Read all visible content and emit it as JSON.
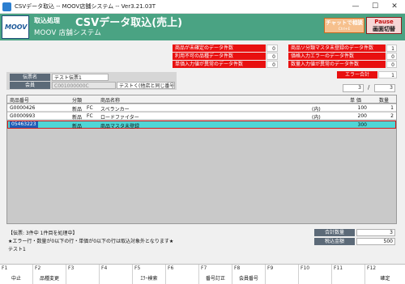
{
  "window": {
    "title": "CSVデータ取込 -- MOOV店舗システム -- Ver3.21.03T",
    "minimize": "—",
    "maximize": "☐",
    "close": "✕"
  },
  "header": {
    "logo_text": "MOOV",
    "mode_label": "取込処理",
    "screen_title": "CSVデータ取込(売上)",
    "system_name": "MOOV 店舗システム",
    "chat_button": "チャットで相談",
    "chat_shortcut": "Ctrl+E",
    "pause_label": "Pause",
    "pause_sub": "画面切替",
    "brand_color": "#4aa383"
  },
  "stats_left": [
    {
      "label": "商品が未確定のデータ件数",
      "value": "0"
    },
    {
      "label": "利用不可の品種データ件数",
      "value": "0"
    },
    {
      "label": "単価入力値が異常のデータ件数",
      "value": "0"
    }
  ],
  "stats_right": [
    {
      "label": "商品ソ分類マスタ未登録のデータ件数",
      "value": "1"
    },
    {
      "label": "価格入力エラーのデータ件数",
      "value": "0"
    },
    {
      "label": "数量入力値が異常のデータ件数",
      "value": "0"
    }
  ],
  "error_count": {
    "label": "エラー合計",
    "value": "1"
  },
  "voucher": {
    "voucher_label": "伝票名",
    "voucher_value": "テスト伝票1",
    "member_label": "会員",
    "member_value": "C001000000C",
    "member_note": "テストく(他店と同じ番号"
  },
  "pager": {
    "current": "3",
    "separator": "/",
    "total": "3"
  },
  "table": {
    "headers": {
      "code": "商品番号",
      "category": "分類",
      "name": "商品名称",
      "unit": "単 価",
      "qty": "数量"
    },
    "rows": [
      {
        "code": "G0000426",
        "cat1": "新品",
        "cat2": "FC",
        "name": "スペランカー",
        "tax": "(内)",
        "unit": "100",
        "qty": "1"
      },
      {
        "code": "G0000993",
        "cat1": "新品",
        "cat2": "FC",
        "name": "ロードファイター",
        "tax": "(内)",
        "unit": "200",
        "qty": "2"
      },
      {
        "code": "05463223",
        "cat1": "新品",
        "cat2": "",
        "name": "商品マスタ未登録",
        "tax": "",
        "unit": "300",
        "qty": ""
      }
    ]
  },
  "messages": {
    "line1": "【伝票:  3件中  1件目を処理中】",
    "line2": "★エラー行・数量が0以下の行・単価が0以下の行は取込対象外となります★",
    "line3": "テスト1"
  },
  "totals": {
    "qty_label": "合計数量",
    "qty_value": "3",
    "amount_label": "税込金額",
    "amount_value": "500"
  },
  "fkeys": [
    {
      "key": "F1",
      "label": "中止"
    },
    {
      "key": "F2",
      "label": "品種変更"
    },
    {
      "key": "F3",
      "label": ""
    },
    {
      "key": "F4",
      "label": ""
    },
    {
      "key": "F5",
      "label": "ｴﾗｰ検索"
    },
    {
      "key": "F6",
      "label": ""
    },
    {
      "key": "F7",
      "label": "番号訂正"
    },
    {
      "key": "F8",
      "label": "会員番号"
    },
    {
      "key": "F9",
      "label": ""
    },
    {
      "key": "F10",
      "label": ""
    },
    {
      "key": "F11",
      "label": ""
    },
    {
      "key": "F12",
      "label": "確定"
    }
  ]
}
